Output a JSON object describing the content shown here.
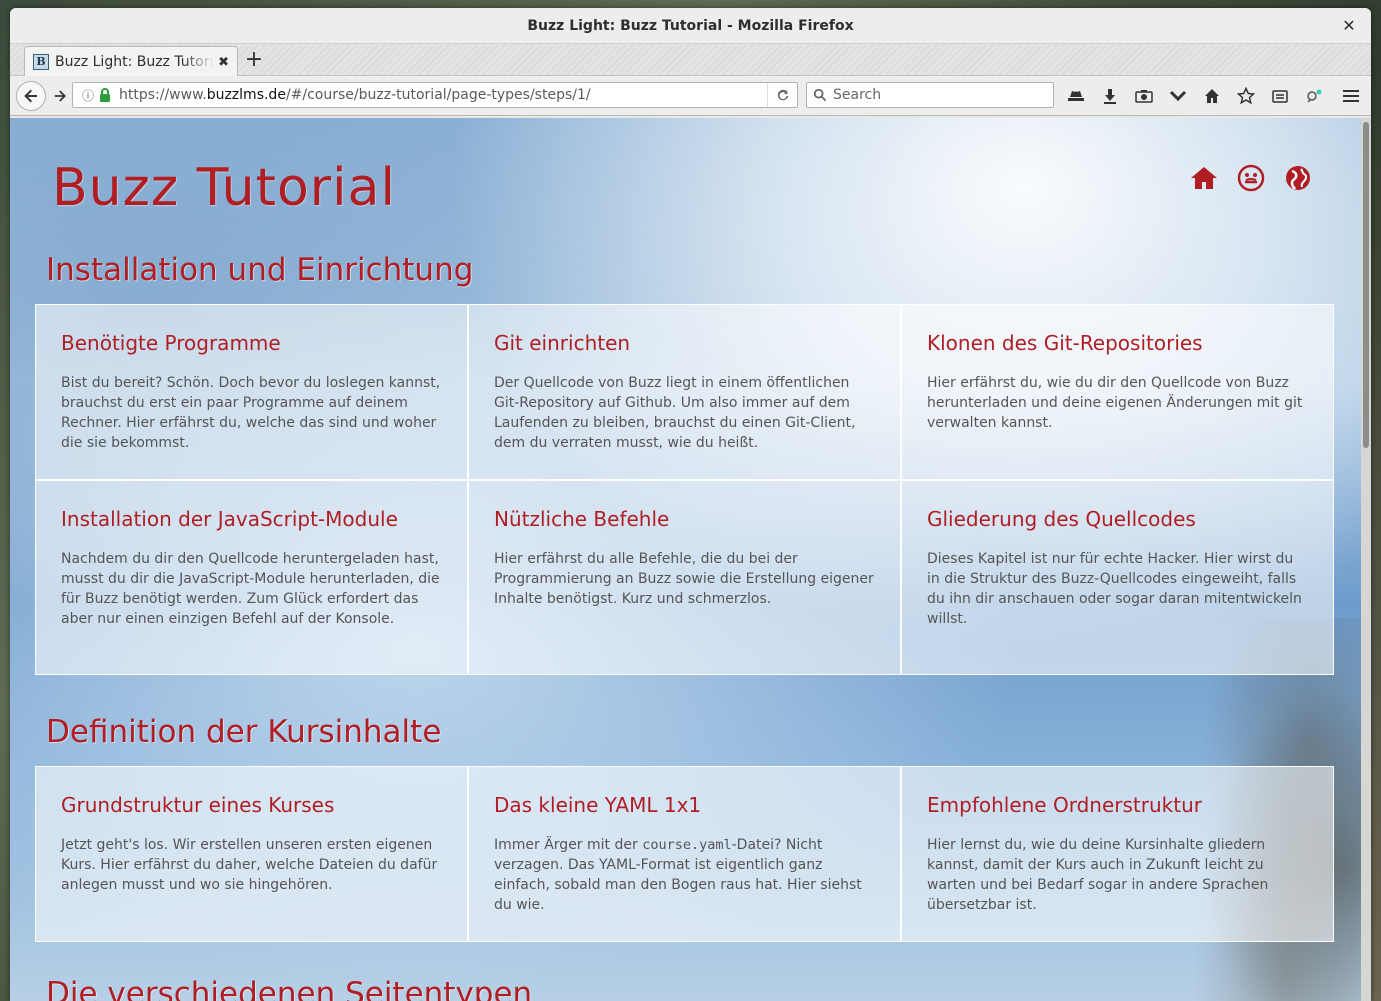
{
  "window": {
    "title": "Buzz Light: Buzz Tutorial - Mozilla Firefox"
  },
  "tabs": [
    {
      "label": "Buzz Light: Buzz Tutorial",
      "favicon": "B"
    }
  ],
  "navbar": {
    "url_prefix": "https://www.",
    "url_domain": "buzzlms.de",
    "url_path": "/#/course/buzz-tutorial/page-types/steps/1/",
    "search_placeholder": "Search"
  },
  "site": {
    "title": "Buzz Tutorial",
    "accent_color": "#b01e24"
  },
  "sections": [
    {
      "title": "Installation und Einrichtung",
      "cards": [
        {
          "title": "Benötigte Programme",
          "text": "Bist du bereit? Schön. Doch bevor du loslegen kannst, brauchst du erst ein paar Programme auf deinem Rechner. Hier erfährst du, welche das sind und woher die sie bekommst."
        },
        {
          "title": "Git einrichten",
          "text": "Der Quellcode von Buzz liegt in einem öffentlichen Git-Repository auf Github. Um also immer auf dem Laufenden zu bleiben, brauchst du einen Git-Client, dem du verraten musst, wie du heißt."
        },
        {
          "title": "Klonen des Git-Repositories",
          "text": "Hier erfährst du, wie du dir den Quellcode von Buzz herunterladen und deine eigenen Änderungen mit git verwalten kannst."
        },
        {
          "title": "Installation der JavaScript-Module",
          "text": "Nachdem du dir den Quellcode heruntergeladen hast, musst du dir die JavaScript-Module herunterladen, die für Buzz benötigt werden. Zum Glück erfordert das aber nur einen einzigen Befehl auf der Konsole."
        },
        {
          "title": "Nützliche Befehle",
          "text": "Hier erfährst du alle Befehle, die du bei der Programmierung an Buzz sowie die Erstellung eigener Inhalte benötigst. Kurz und schmerzlos."
        },
        {
          "title": "Gliederung des Quellcodes",
          "text": "Dieses Kapitel ist nur für echte Hacker. Hier wirst du in die Struktur des Buzz-Quellcodes eingeweiht, falls du ihn dir anschauen oder sogar daran mitentwickeln willst."
        }
      ]
    },
    {
      "title": "Definition der Kursinhalte",
      "cards": [
        {
          "title": "Grundstruktur eines Kurses",
          "text": "Jetzt geht's los. Wir erstellen unseren ersten eigenen Kurs. Hier erfährst du daher, welche Dateien du dafür anlegen musst und wo sie hingehören."
        },
        {
          "title": "Das kleine YAML 1x1",
          "text_before": "Immer Ärger mit der ",
          "code": "course.yaml",
          "text_after": "-Datei? Nicht verzagen. Das YAML-Format ist eigentlich ganz einfach, sobald man den Bogen raus hat. Hier siehst du wie."
        },
        {
          "title": "Empfohlene Ordnerstruktur",
          "text": "Hier lernst du, wie du deine Kursinhalte gliedern kannst, damit der Kurs auch in Zukunft leicht zu warten und bei Bedarf sogar in andere Sprachen übersetzbar ist."
        }
      ]
    },
    {
      "title": "Die verschiedenen Seitentypen"
    }
  ]
}
